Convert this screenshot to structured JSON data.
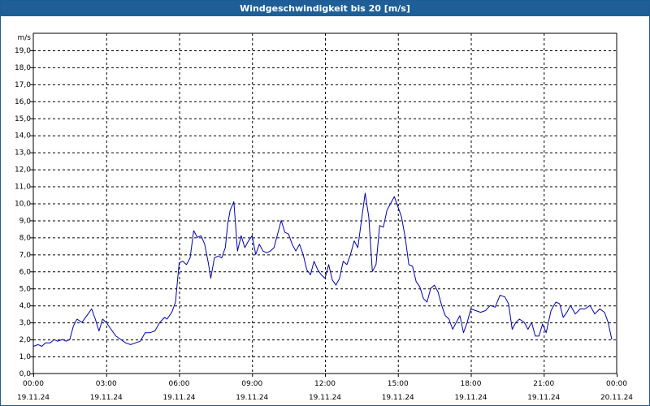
{
  "window": {
    "title": "Windgeschwindigkeit bis 20 [m/s]"
  },
  "colors": {
    "titlebar": "#1f5f97",
    "line": "#0000aa",
    "grid": "#000000"
  },
  "chart_data": {
    "type": "line",
    "title": "Windgeschwindigkeit bis 20 [m/s]",
    "ylabel": "m/s",
    "ylim": [
      0,
      20
    ],
    "xlim_hours": [
      0,
      24
    ],
    "grid": true,
    "y_ticks": [
      "0,0",
      "1,0",
      "2,0",
      "3,0",
      "4,0",
      "5,0",
      "6,0",
      "7,0",
      "8,0",
      "9,0",
      "10,0",
      "11,0",
      "12,0",
      "13,0",
      "14,0",
      "15,0",
      "16,0",
      "17,0",
      "18,0",
      "19,0"
    ],
    "x_ticks": [
      {
        "time": "00:00",
        "date": "19.11.24"
      },
      {
        "time": "03:00",
        "date": "19.11.24"
      },
      {
        "time": "06:00",
        "date": "19.11.24"
      },
      {
        "time": "09:00",
        "date": "19.11.24"
      },
      {
        "time": "12:00",
        "date": "19.11.24"
      },
      {
        "time": "15:00",
        "date": "19.11.24"
      },
      {
        "time": "18:00",
        "date": "19.11.24"
      },
      {
        "time": "21:00",
        "date": "19.11.24"
      },
      {
        "time": "00:00",
        "date": "20.11.24"
      }
    ],
    "series": [
      {
        "points": [
          [
            0.0,
            1.6
          ],
          [
            0.2,
            1.7
          ],
          [
            0.35,
            1.6
          ],
          [
            0.5,
            1.8
          ],
          [
            0.7,
            1.8
          ],
          [
            0.85,
            2.0
          ],
          [
            1.0,
            1.9
          ],
          [
            1.2,
            2.0
          ],
          [
            1.35,
            1.9
          ],
          [
            1.5,
            2.0
          ],
          [
            1.65,
            2.8
          ],
          [
            1.8,
            3.2
          ],
          [
            2.0,
            3.0
          ],
          [
            2.2,
            3.4
          ],
          [
            2.4,
            3.8
          ],
          [
            2.55,
            3.2
          ],
          [
            2.7,
            2.5
          ],
          [
            2.85,
            3.2
          ],
          [
            3.0,
            3.0
          ],
          [
            3.2,
            2.6
          ],
          [
            3.4,
            2.2
          ],
          [
            3.6,
            2.0
          ],
          [
            3.8,
            1.8
          ],
          [
            4.0,
            1.7
          ],
          [
            4.2,
            1.8
          ],
          [
            4.4,
            1.9
          ],
          [
            4.6,
            2.4
          ],
          [
            4.8,
            2.4
          ],
          [
            5.0,
            2.5
          ],
          [
            5.2,
            3.0
          ],
          [
            5.4,
            3.3
          ],
          [
            5.5,
            3.2
          ],
          [
            5.7,
            3.6
          ],
          [
            5.85,
            4.2
          ],
          [
            6.0,
            6.5
          ],
          [
            6.15,
            6.6
          ],
          [
            6.3,
            6.4
          ],
          [
            6.45,
            6.8
          ],
          [
            6.6,
            8.4
          ],
          [
            6.75,
            8.0
          ],
          [
            6.9,
            8.1
          ],
          [
            7.05,
            7.6
          ],
          [
            7.2,
            6.5
          ],
          [
            7.3,
            5.6
          ],
          [
            7.45,
            6.8
          ],
          [
            7.6,
            6.9
          ],
          [
            7.75,
            6.8
          ],
          [
            7.9,
            7.4
          ],
          [
            8.0,
            8.8
          ],
          [
            8.1,
            9.6
          ],
          [
            8.25,
            10.1
          ],
          [
            8.4,
            7.2
          ],
          [
            8.55,
            8.1
          ],
          [
            8.7,
            7.4
          ],
          [
            8.85,
            7.8
          ],
          [
            9.0,
            8.1
          ],
          [
            9.15,
            7.0
          ],
          [
            9.3,
            7.6
          ],
          [
            9.45,
            7.2
          ],
          [
            9.6,
            7.1
          ],
          [
            9.75,
            7.2
          ],
          [
            9.9,
            7.4
          ],
          [
            10.05,
            8.2
          ],
          [
            10.2,
            9.0
          ],
          [
            10.35,
            8.3
          ],
          [
            10.5,
            8.2
          ],
          [
            10.65,
            7.6
          ],
          [
            10.8,
            7.2
          ],
          [
            10.95,
            7.6
          ],
          [
            11.1,
            7.0
          ],
          [
            11.25,
            6.1
          ],
          [
            11.4,
            5.8
          ],
          [
            11.55,
            6.6
          ],
          [
            11.7,
            6.1
          ],
          [
            11.85,
            5.8
          ],
          [
            12.0,
            5.6
          ],
          [
            12.15,
            6.4
          ],
          [
            12.3,
            5.5
          ],
          [
            12.45,
            5.2
          ],
          [
            12.6,
            5.6
          ],
          [
            12.75,
            6.6
          ],
          [
            12.9,
            6.4
          ],
          [
            13.05,
            7.0
          ],
          [
            13.2,
            7.8
          ],
          [
            13.35,
            7.4
          ],
          [
            13.5,
            9.0
          ],
          [
            13.65,
            10.6
          ],
          [
            13.8,
            9.2
          ],
          [
            13.95,
            6.0
          ],
          [
            14.1,
            6.4
          ],
          [
            14.25,
            8.7
          ],
          [
            14.4,
            8.6
          ],
          [
            14.55,
            9.6
          ],
          [
            14.7,
            10.0
          ],
          [
            14.85,
            10.4
          ],
          [
            15.0,
            9.8
          ],
          [
            15.15,
            9.2
          ],
          [
            15.3,
            8.0
          ],
          [
            15.45,
            6.4
          ],
          [
            15.6,
            6.3
          ],
          [
            15.75,
            5.4
          ],
          [
            15.9,
            5.1
          ],
          [
            16.05,
            4.4
          ],
          [
            16.2,
            4.2
          ],
          [
            16.35,
            5.0
          ],
          [
            16.5,
            5.2
          ],
          [
            16.65,
            4.8
          ],
          [
            16.8,
            4.0
          ],
          [
            16.95,
            3.4
          ],
          [
            17.1,
            3.2
          ],
          [
            17.25,
            2.6
          ],
          [
            17.4,
            3.0
          ],
          [
            17.55,
            3.4
          ],
          [
            17.7,
            2.4
          ],
          [
            17.85,
            3.0
          ],
          [
            18.0,
            3.8
          ],
          [
            18.2,
            3.7
          ],
          [
            18.4,
            3.6
          ],
          [
            18.6,
            3.7
          ],
          [
            18.8,
            4.0
          ],
          [
            19.0,
            3.9
          ],
          [
            19.2,
            4.6
          ],
          [
            19.4,
            4.5
          ],
          [
            19.55,
            4.1
          ],
          [
            19.7,
            2.6
          ],
          [
            19.85,
            3.0
          ],
          [
            20.0,
            3.2
          ],
          [
            20.2,
            3.0
          ],
          [
            20.35,
            2.6
          ],
          [
            20.5,
            3.0
          ],
          [
            20.65,
            2.2
          ],
          [
            20.8,
            2.2
          ],
          [
            20.95,
            2.9
          ],
          [
            21.1,
            2.4
          ],
          [
            21.3,
            3.7
          ],
          [
            21.5,
            4.2
          ],
          [
            21.65,
            4.1
          ],
          [
            21.8,
            3.3
          ],
          [
            21.95,
            3.6
          ],
          [
            22.1,
            4.0
          ],
          [
            22.3,
            3.5
          ],
          [
            22.5,
            3.8
          ],
          [
            22.7,
            3.8
          ],
          [
            22.9,
            4.0
          ],
          [
            23.1,
            3.5
          ],
          [
            23.3,
            3.8
          ],
          [
            23.5,
            3.6
          ],
          [
            23.65,
            3.0
          ],
          [
            23.8,
            2.0
          ]
        ]
      }
    ]
  }
}
